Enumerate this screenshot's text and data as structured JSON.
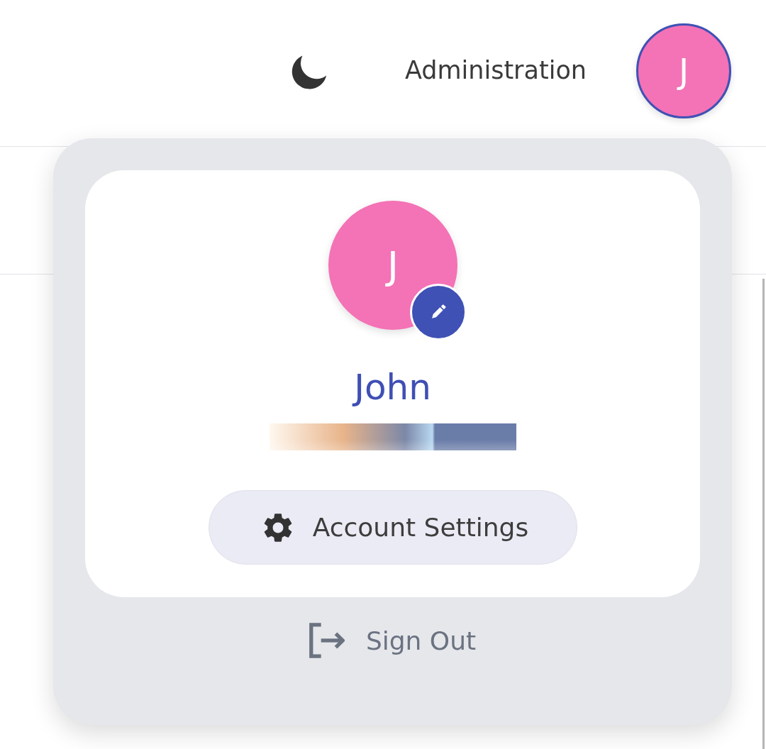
{
  "header": {
    "nav_link": "Administration",
    "avatar_initial": "J"
  },
  "account_menu": {
    "avatar_initial": "J",
    "name": "John",
    "actions": [
      {
        "kind": "settings",
        "label": "Account Settings"
      }
    ],
    "sign_out": "Sign Out"
  }
}
